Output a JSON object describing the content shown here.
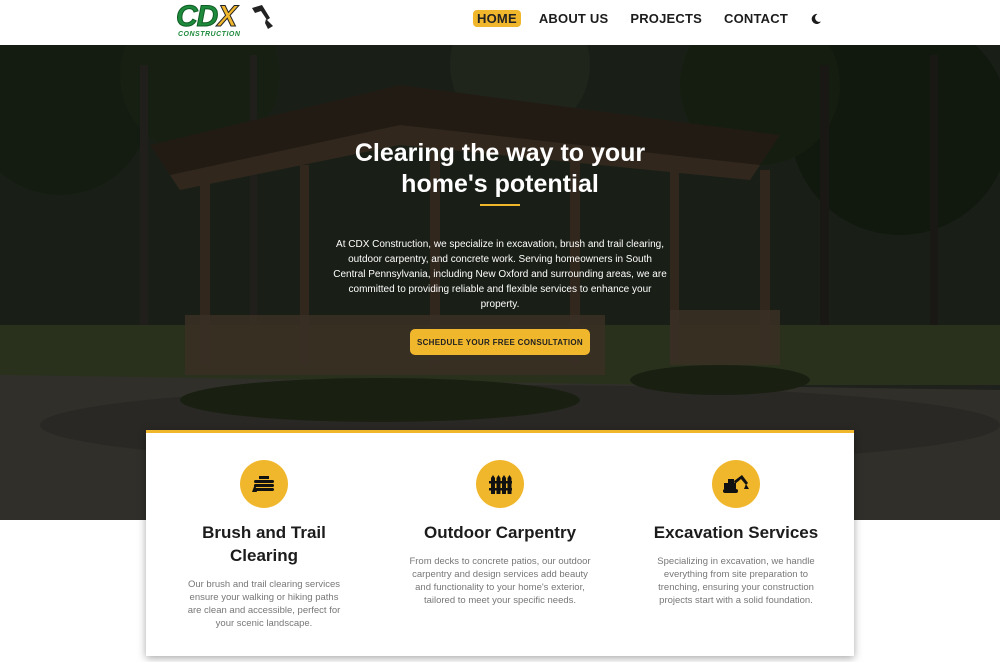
{
  "brand": {
    "logo_text": "CD",
    "logo_x": "X",
    "logo_sub": "CONSTRUCTION"
  },
  "nav": {
    "items": [
      {
        "label": "HOME",
        "active": true
      },
      {
        "label": "ABOUT US",
        "active": false
      },
      {
        "label": "PROJECTS",
        "active": false
      },
      {
        "label": "CONTACT",
        "active": false
      }
    ],
    "theme_toggle_icon": "moon-icon"
  },
  "hero": {
    "title": "Clearing the way to your home's potential",
    "description": "At CDX Construction, we specialize in excavation, brush and trail clearing, outdoor carpentry, and concrete work. Serving homeowners in South Central Pennsylvania, including New Oxford and surrounding areas, we are committed to providing reliable and flexible services to enhance your property.",
    "cta_label": "SCHEDULE YOUR FREE CONSULTATION"
  },
  "services": [
    {
      "icon": "log-pile-icon",
      "title": "Brush and Trail Clearing",
      "description": "Our brush and trail clearing services ensure your walking or hiking paths are clean and accessible, perfect for your scenic landscape."
    },
    {
      "icon": "fence-icon",
      "title": "Outdoor Carpentry",
      "description": "From decks to concrete patios, our outdoor carpentry and design services add beauty and functionality to your home's exterior, tailored to meet your specific needs."
    },
    {
      "icon": "excavator-icon",
      "title": "Excavation Services",
      "description": "Specializing in excavation, we handle everything from site preparation to trenching, ensuring your construction projects start with a solid foundation."
    }
  ],
  "colors": {
    "accent": "#f1b72c",
    "brand_green": "#1e8a3c",
    "text_dark": "#1c1c1c",
    "text_muted": "#777777"
  }
}
